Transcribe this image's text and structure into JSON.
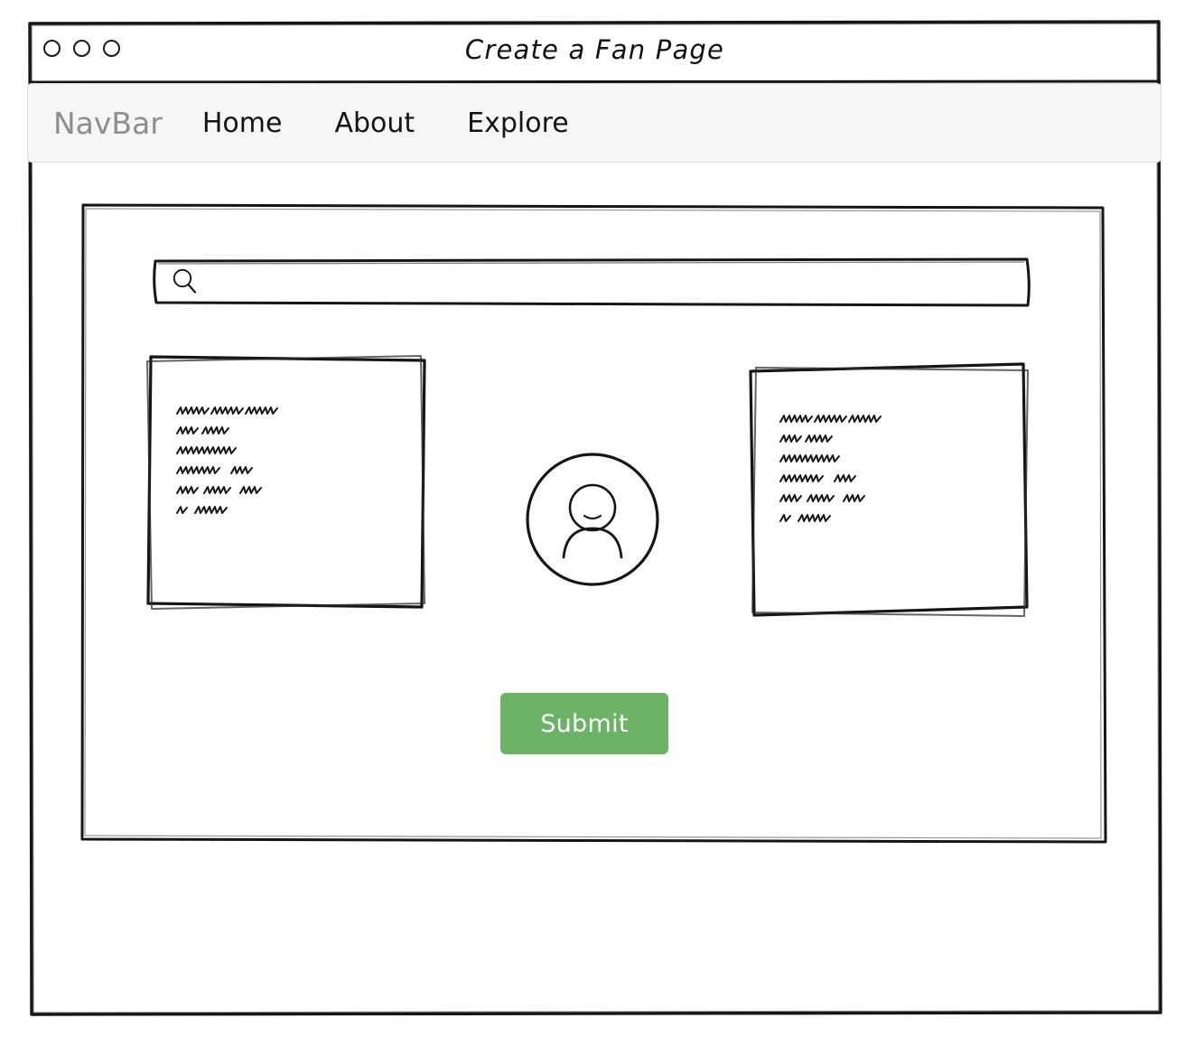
{
  "window": {
    "title": "Create a Fan Page",
    "controls": [
      {
        "name": "close-circle"
      },
      {
        "name": "minimize-circle"
      },
      {
        "name": "maximize-circle"
      }
    ]
  },
  "navbar": {
    "brand": "NavBar",
    "brand_color": "#8e8e8e",
    "background": "#f6f6f6",
    "links": [
      {
        "label": "Home"
      },
      {
        "label": "About"
      },
      {
        "label": "Explore"
      }
    ]
  },
  "content": {
    "search": {
      "icon": "search-icon",
      "value": "",
      "placeholder": ""
    },
    "cards": [
      {
        "id": "left",
        "placeholder_text": "squiggle-lorem-ipsum",
        "line_count": 6
      },
      {
        "id": "right",
        "placeholder_text": "squiggle-lorem-ipsum",
        "line_count": 6
      }
    ],
    "avatar": {
      "icon": "user-avatar-icon"
    },
    "submit": {
      "label": "Submit",
      "color": "#6cb267",
      "text_color": "#ffffff"
    }
  }
}
